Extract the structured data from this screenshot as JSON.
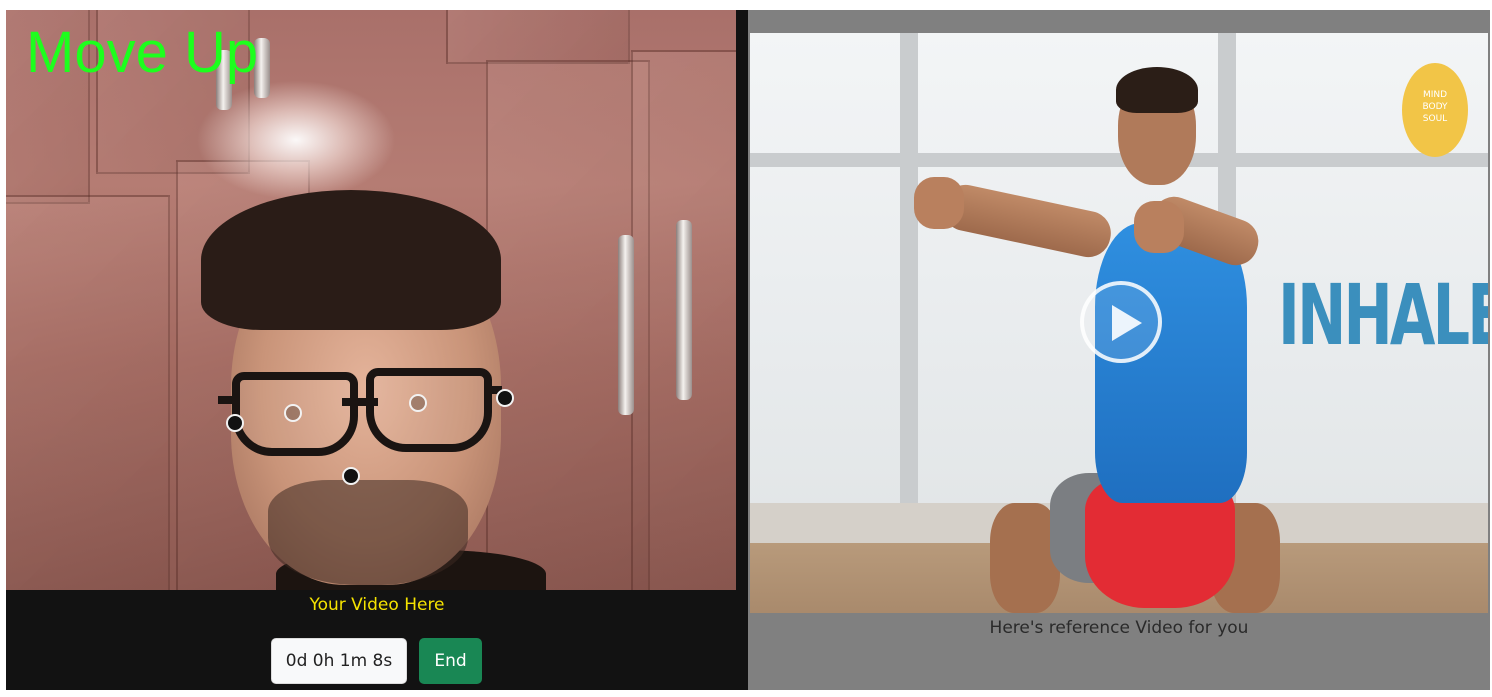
{
  "webcam": {
    "feedback_text": "Move Up",
    "feedback_color": "#1dff1d",
    "caption": "Your Video Here",
    "caption_color": "#f5e300"
  },
  "controls": {
    "timer_label": "0d 0h 1m 8s",
    "end_label": "End",
    "end_color": "#198754"
  },
  "reference": {
    "overlay_text": "INHALE",
    "logo_lines": [
      "MIND",
      "BODY",
      "SOUL"
    ],
    "play_icon": "play-icon",
    "caption": "Here's reference Video for you",
    "accent_color": "#3b8fbd"
  }
}
